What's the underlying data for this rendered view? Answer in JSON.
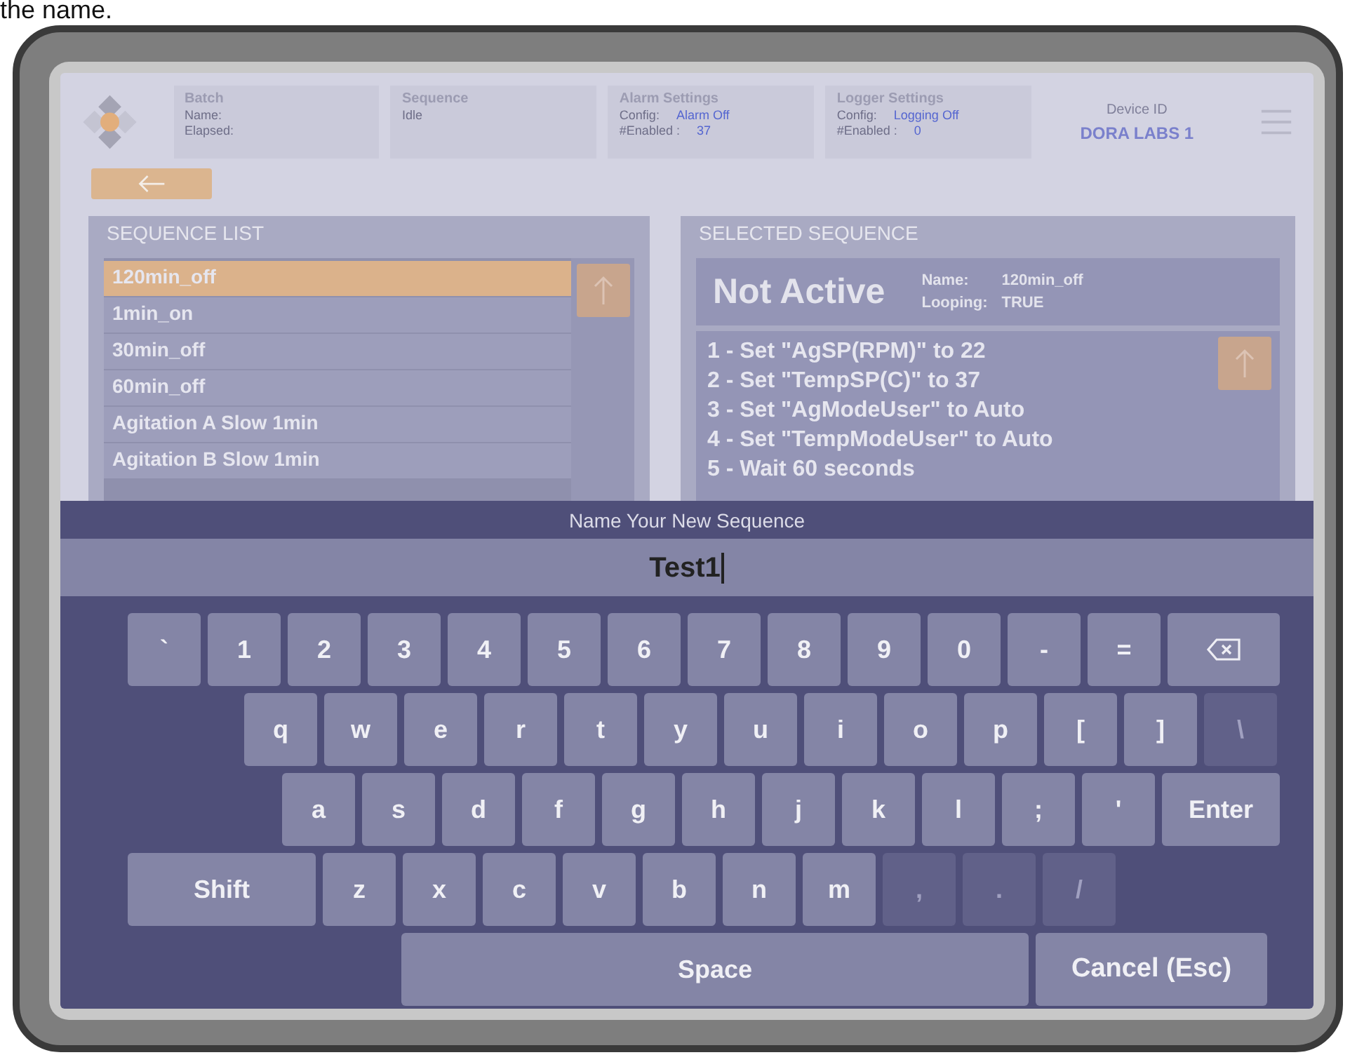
{
  "caption": "the name.",
  "header": {
    "cards": [
      {
        "title": "Batch",
        "rows": [
          {
            "label": "Name:"
          },
          {
            "label": "Elapsed:"
          }
        ]
      },
      {
        "title": "Sequence",
        "rows": [
          {
            "label": "Idle"
          }
        ]
      },
      {
        "title": "Alarm Settings",
        "rows": [
          {
            "label": "Config:",
            "value": "Alarm Off"
          },
          {
            "label": "#Enabled :",
            "value": "37"
          }
        ]
      },
      {
        "title": "Logger Settings",
        "rows": [
          {
            "label": "Config:",
            "value": "Logging Off"
          },
          {
            "label": "#Enabled :",
            "value": "0"
          }
        ]
      }
    ],
    "device": {
      "label": "Device ID",
      "value": "DORA LABS 1"
    }
  },
  "sequence_list": {
    "title": "SEQUENCE LIST",
    "items": [
      {
        "label": "120min_off",
        "selected": true
      },
      {
        "label": "1min_on",
        "selected": false
      },
      {
        "label": "30min_off",
        "selected": false
      },
      {
        "label": "60min_off",
        "selected": false
      },
      {
        "label": "Agitation A Slow 1min",
        "selected": false
      },
      {
        "label": "Agitation B Slow 1min",
        "selected": false
      }
    ]
  },
  "selected_sequence": {
    "title": "SELECTED SEQUENCE",
    "status": "Not Active",
    "name_label": "Name:",
    "name": "120min_off",
    "looping_label": "Looping:",
    "looping": "TRUE",
    "steps": [
      "1 - Set \"AgSP(RPM)\" to 22",
      "2 - Set \"TempSP(C)\" to 37",
      "3 - Set \"AgModeUser\" to Auto",
      "4 - Set \"TempModeUser\" to Auto",
      "5 - Wait 60 seconds"
    ]
  },
  "keyboard": {
    "title": "Name Your New Sequence",
    "value": "Test1",
    "key_rows": [
      {
        "keys": [
          {
            "kind": "key",
            "label": "`",
            "disabled": false
          },
          {
            "kind": "key",
            "label": "1",
            "disabled": false
          },
          {
            "kind": "key",
            "label": "2",
            "disabled": false
          },
          {
            "kind": "key",
            "label": "3",
            "disabled": false
          },
          {
            "kind": "key",
            "label": "4",
            "disabled": false
          },
          {
            "kind": "key",
            "label": "5",
            "disabled": false
          },
          {
            "kind": "key",
            "label": "6",
            "disabled": false
          },
          {
            "kind": "key",
            "label": "7",
            "disabled": false
          },
          {
            "kind": "key",
            "label": "8",
            "disabled": false
          },
          {
            "kind": "key",
            "label": "9",
            "disabled": false
          },
          {
            "kind": "key",
            "label": "0",
            "disabled": false
          },
          {
            "kind": "key",
            "label": "-",
            "disabled": false
          },
          {
            "kind": "key",
            "label": "=",
            "disabled": false
          },
          {
            "kind": "backspace",
            "disabled": false
          }
        ]
      },
      {
        "keys": [
          {
            "kind": "key",
            "label": "q",
            "disabled": false
          },
          {
            "kind": "key",
            "label": "w",
            "disabled": false
          },
          {
            "kind": "key",
            "label": "e",
            "disabled": false
          },
          {
            "kind": "key",
            "label": "r",
            "disabled": false
          },
          {
            "kind": "key",
            "label": "t",
            "disabled": false
          },
          {
            "kind": "key",
            "label": "y",
            "disabled": false
          },
          {
            "kind": "key",
            "label": "u",
            "disabled": false
          },
          {
            "kind": "key",
            "label": "i",
            "disabled": false
          },
          {
            "kind": "key",
            "label": "o",
            "disabled": false
          },
          {
            "kind": "key",
            "label": "p",
            "disabled": false
          },
          {
            "kind": "key",
            "label": "[",
            "disabled": false
          },
          {
            "kind": "key",
            "label": "]",
            "disabled": false
          },
          {
            "kind": "key",
            "label": "\\",
            "disabled": true
          }
        ]
      },
      {
        "keys": [
          {
            "kind": "key",
            "label": "a",
            "disabled": false
          },
          {
            "kind": "key",
            "label": "s",
            "disabled": false
          },
          {
            "kind": "key",
            "label": "d",
            "disabled": false
          },
          {
            "kind": "key",
            "label": "f",
            "disabled": false
          },
          {
            "kind": "key",
            "label": "g",
            "disabled": false
          },
          {
            "kind": "key",
            "label": "h",
            "disabled": false
          },
          {
            "kind": "key",
            "label": "j",
            "disabled": false
          },
          {
            "kind": "key",
            "label": "k",
            "disabled": false
          },
          {
            "kind": "key",
            "label": "l",
            "disabled": false
          },
          {
            "kind": "key",
            "label": ";",
            "disabled": false
          },
          {
            "kind": "key",
            "label": "'",
            "disabled": false
          },
          {
            "kind": "wide",
            "label": "Enter",
            "disabled": false
          }
        ]
      },
      {
        "keys": [
          {
            "kind": "shift",
            "label": "Shift",
            "disabled": false
          },
          {
            "kind": "key",
            "label": "z",
            "disabled": false
          },
          {
            "kind": "key",
            "label": "x",
            "disabled": false
          },
          {
            "kind": "key",
            "label": "c",
            "disabled": false
          },
          {
            "kind": "key",
            "label": "v",
            "disabled": false
          },
          {
            "kind": "key",
            "label": "b",
            "disabled": false
          },
          {
            "kind": "key",
            "label": "n",
            "disabled": false
          },
          {
            "kind": "key",
            "label": "m",
            "disabled": false
          },
          {
            "kind": "key",
            "label": ",",
            "disabled": true
          },
          {
            "kind": "key",
            "label": ".",
            "disabled": true
          },
          {
            "kind": "key",
            "label": "/",
            "disabled": true
          }
        ]
      },
      {
        "keys": [
          {
            "kind": "space",
            "label": "Space",
            "disabled": false
          },
          {
            "kind": "cancel",
            "label": "Cancel (Esc)",
            "disabled": false
          }
        ]
      }
    ]
  }
}
